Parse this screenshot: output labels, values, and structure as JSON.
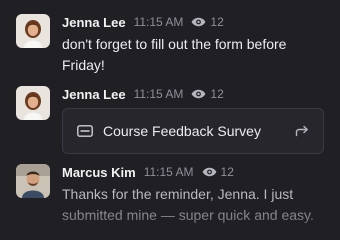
{
  "messages": [
    {
      "author": "Jenna Lee",
      "time": "11:15 AM",
      "views": "12",
      "text": "don't forget to fill out the form before Friday!"
    },
    {
      "author": "Jenna Lee",
      "time": "11:15 AM",
      "views": "12",
      "attachment": {
        "title": "Course Feedback Survey",
        "icon": "form-icon",
        "action_icon": "share-arrow-icon"
      }
    },
    {
      "author": "Marcus Kim",
      "time": "11:15 AM",
      "views": "12",
      "text": "Thanks for the reminder, Jenna. I just submitted mine — super quick and easy."
    }
  ],
  "colors": {
    "background": "#1f1f24",
    "card": "#26262c",
    "muted": "#8f8f99"
  }
}
